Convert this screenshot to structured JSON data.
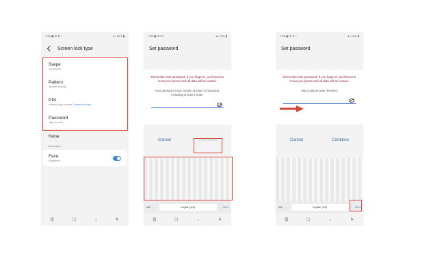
{
  "phone1": {
    "status": {
      "time": "7:55",
      "icons": "▣ ✆ ⚙ •",
      "battery": "◂ ᵢₗ 19% ▮"
    },
    "header": {
      "title": "Screen lock type"
    },
    "options": [
      {
        "title": "Swipe",
        "sub": "No security"
      },
      {
        "title": "Pattern",
        "sub": "Medium security"
      },
      {
        "title": "PIN",
        "sub": "Medium-high security",
        "link": "Current lock type"
      },
      {
        "title": "Password",
        "sub": "High security"
      }
    ],
    "none_label": "None",
    "section_label": "Biometrics",
    "face": {
      "title": "Face",
      "sub": "Registered",
      "enabled": true
    },
    "nav": {
      "recents": "|||",
      "home": "▢",
      "back": "‹",
      "accessibility": "♿"
    }
  },
  "phone2": {
    "status": {
      "time": "7:56",
      "icons": "▣ ✆ ⚙ •",
      "battery": "◂ ᵢₗ 19% ▮"
    },
    "header": {
      "title": "Set password"
    },
    "warning": "Remember this password. If you forget it, you'll need to reset your phone and all data will be erased.",
    "info": "Your password must contain at least 4 characters, including at least 1 letter.",
    "cancel_label": "Cancel",
    "continue_label": "Continue",
    "keyboard": {
      "symbols": "!#1",
      "comma": ",",
      "space": "English (US)",
      "period": ".",
      "next": "Next"
    },
    "nav": {
      "recents": "|||",
      "home": "▢",
      "hide": "⌄",
      "accessibility": "♿"
    }
  },
  "phone3": {
    "status": {
      "time": "7:55",
      "icons": "▣ ✆ ⚙ •",
      "battery": "◂ ᵢₗ 19% ▮"
    },
    "header": {
      "title": "Set password"
    },
    "warning": "Remember this password. If you forget it, you'll need to reset your phone and all data will be erased.",
    "info": "Tap Continue when finished.",
    "cancel_label": "Cancel",
    "continue_label": "Continue",
    "keyboard": {
      "symbols": "!#1",
      "comma": ",",
      "space": "English (US)",
      "period": ".",
      "next": "Next"
    },
    "nav": {
      "recents": "|||",
      "home": "▢",
      "hide": "⌄",
      "accessibility": "♿"
    }
  },
  "colors": {
    "highlight": "#d94636",
    "accent": "#2f6ba6",
    "warning_text": "#8a1f2b",
    "toggle": "#3e86d9"
  }
}
